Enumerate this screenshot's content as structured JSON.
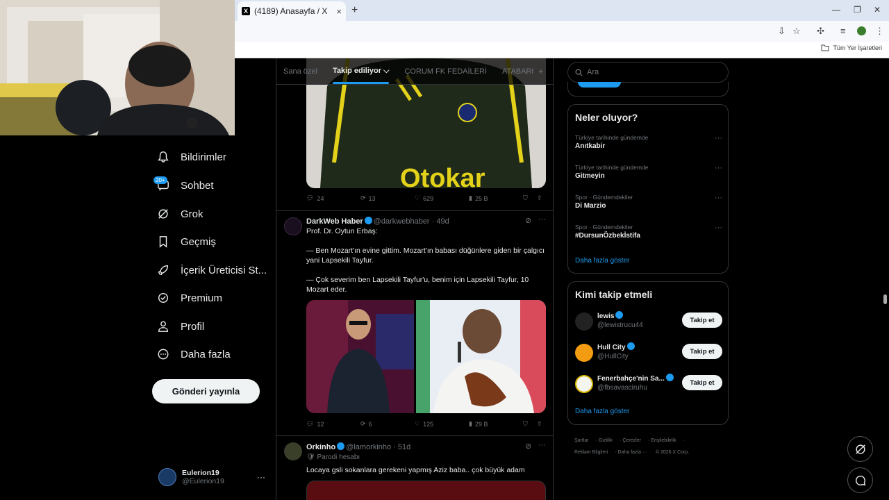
{
  "browser": {
    "tab_title": "(4189) Anasayfa / X",
    "bookmarks_label": "Tüm Yer İşaretleri"
  },
  "nav": {
    "items": [
      {
        "label": "Bildirimler"
      },
      {
        "label": "Sohbet",
        "badge": "20+"
      },
      {
        "label": "Grok"
      },
      {
        "label": "Geçmiş"
      },
      {
        "label": "İçerik Üreticisi St..."
      },
      {
        "label": "Premium"
      },
      {
        "label": "Profil"
      },
      {
        "label": "Daha fazla"
      }
    ],
    "post_button": "Gönderi yayınla",
    "account": {
      "name": "Eulerion19",
      "handle": "@Eulerion19"
    }
  },
  "timeline": {
    "tabs": [
      "Sana özel",
      "Takip ediliyor",
      "ÇORUM FK FEDAİLERİ",
      "ATABARI"
    ],
    "active_tab": "Takip ediliyor",
    "tweet1_stats": {
      "replies": "24",
      "retweets": "13",
      "likes": "629",
      "views": "25 B"
    },
    "tweet2": {
      "name": "DarkWeb Haber",
      "handle": "@darkwebhaber · 49d",
      "line1": "Prof. Dr. Oytun Erbaş:",
      "line2": "— Ben Mozart'ın evine gittim. Mozart'ın babası düğünlere giden bir çalgıcı yani Lapsekili Tayfur.",
      "line3": "— Çok severim ben Lapsekili Tayfur'u, benim için Lapsekili Tayfur, 10 Mozart eder.",
      "stats": {
        "replies": "12",
        "retweets": "6",
        "likes": "125",
        "views": "29 B"
      }
    },
    "tweet3": {
      "name": "Orkinho",
      "handle": "@lamorkinho · 51d",
      "label": "Parodi hesabı",
      "text": "Locaya gsli sokanlara gerekeni yapmış Aziz baba.. çok büyük adam"
    }
  },
  "right": {
    "search_placeholder": "Ara",
    "trends_title": "Neler oluyor?",
    "trends": [
      {
        "context": "Türkiye tarihinde gündemde",
        "name": "Anıtkabir"
      },
      {
        "context": "Türkiye tarihinde gündemde",
        "name": "Gitmeyin"
      },
      {
        "context": "Spor · Gündemdekiler",
        "name": "Di Marzio"
      },
      {
        "context": "Spor · Gündemdekiler",
        "name": "#DursunÖzbekİstifa"
      }
    ],
    "show_more": "Daha fazla göster",
    "who_title": "Kimi takip etmeli",
    "who": [
      {
        "name": "lewis",
        "handle": "@lewistrucu44",
        "button": "Takip et"
      },
      {
        "name": "Hull City",
        "handle": "@HullCity",
        "button": "Takip et"
      },
      {
        "name": "Fenerbahçe'nin Sa...",
        "handle": "@fbsavasciruhu",
        "button": "Takip et"
      }
    ],
    "footer": [
      "Şartlar",
      "Gizlilik",
      "Çerezler",
      "Erişilebilirlik",
      "Reklam Bilgileri",
      "Daha fazla ···",
      "© 2026 X Corp."
    ]
  },
  "colors": {
    "accent": "#1d9bf0",
    "background": "#000000",
    "border": "#2f3336"
  }
}
